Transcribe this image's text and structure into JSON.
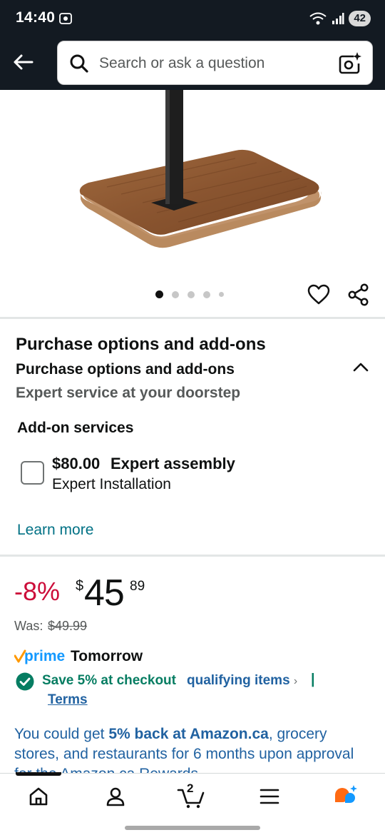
{
  "status_bar": {
    "time": "14:40",
    "battery": "42"
  },
  "search": {
    "placeholder": "Search or ask a question"
  },
  "carousel": {
    "dot_count": 5,
    "active_index": 0
  },
  "purchase_options": {
    "title": "Purchase options and add-ons",
    "subtitle": "Purchase options and add-ons",
    "description": "Expert service at your doorstep",
    "addon_heading": "Add-on services",
    "addon": {
      "price": "$80.00",
      "name": "Expert assembly",
      "sub": "Expert Installation"
    },
    "learn_more": "Learn more"
  },
  "pricing": {
    "discount": "-8%",
    "currency": "$",
    "whole": "45",
    "fraction": "89",
    "was_label": "Was:",
    "was_price": "$49.99"
  },
  "delivery": {
    "prime_logo": "prime",
    "prime_text": "Tomorrow"
  },
  "offer": {
    "save_text": "Save 5% at checkout",
    "qualifying": "qualifying items",
    "qualifying_chevron": "›",
    "pipe": "|",
    "terms": "Terms"
  },
  "cashback": {
    "prefix": "You could get ",
    "highlight": "5% back at Amazon.ca",
    "suffix": ", grocery stores, and restaurants for 6 months upon approval for the Amazon.ca Rewards"
  },
  "bottom_nav": {
    "cart_count": "2",
    "items": [
      "home-icon",
      "account-icon",
      "cart-icon",
      "menu-icon",
      "rufus-icon"
    ]
  },
  "colors": {
    "header_bg": "#131a22",
    "discount": "#cc0c39",
    "link": "#007185",
    "offer_green": "#067d62",
    "prime_blue": "#1399ff",
    "prime_orange": "#ff9900"
  }
}
